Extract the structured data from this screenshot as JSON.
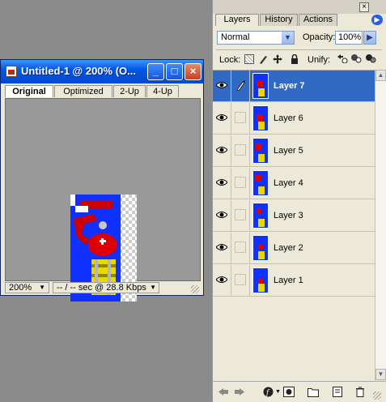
{
  "document": {
    "title": "Untitled-1 @ 200% (O...",
    "tabs": [
      {
        "label": "Original"
      },
      {
        "label": "Optimized"
      },
      {
        "label": "2-Up"
      },
      {
        "label": "4-Up"
      }
    ],
    "zoom": "200%",
    "download_info": "-- / -- sec @ 28.8 Kbps"
  },
  "palette": {
    "tabs": [
      {
        "label": "Layers"
      },
      {
        "label": "History"
      },
      {
        "label": "Actions"
      }
    ],
    "blend_mode": "Normal",
    "opacity_label": "Opacity:",
    "opacity_value": "100%",
    "lock_label": "Lock:",
    "unify_label": "Unify:",
    "layers": [
      {
        "name": "Layer 7",
        "selected": true
      },
      {
        "name": "Layer 6",
        "selected": false
      },
      {
        "name": "Layer 5",
        "selected": false
      },
      {
        "name": "Layer 4",
        "selected": false
      },
      {
        "name": "Layer 3",
        "selected": false
      },
      {
        "name": "Layer 2",
        "selected": false
      },
      {
        "name": "Layer 1",
        "selected": false
      }
    ]
  },
  "colors": {
    "titlebar": "#0058e6",
    "selection": "#316ac5",
    "art_blue": "#1030ff",
    "art_red": "#e00000",
    "art_yellow": "#e8d800"
  }
}
